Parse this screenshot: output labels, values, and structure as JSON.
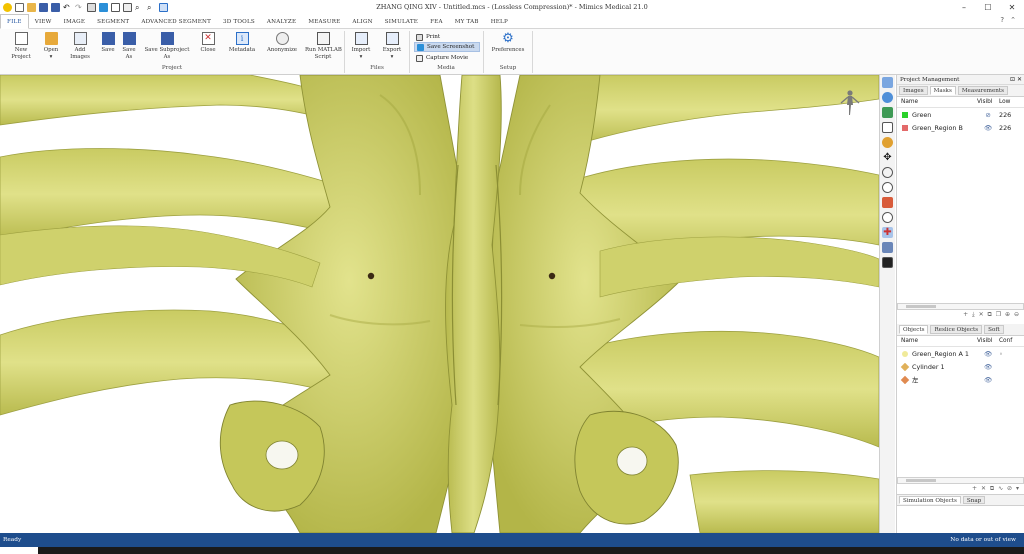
{
  "window": {
    "title": "ZHANG QING XIV - Untitled.mcs - (Lossless Compression)* - Mimics Medical 21.0",
    "controls": [
      "–",
      "☐",
      "✕"
    ]
  },
  "menu": {
    "tabs": [
      "FILE",
      "VIEW",
      "IMAGE",
      "SEGMENT",
      "ADVANCED SEGMENT",
      "3D TOOLS",
      "ANALYZE",
      "MEASURE",
      "ALIGN",
      "SIMULATE",
      "FEA",
      "MY TAB",
      "HELP"
    ],
    "active": "FILE",
    "right_icons": [
      "?",
      "⌃"
    ]
  },
  "ribbon": {
    "project_buttons": [
      {
        "label": "New\nProject",
        "icon": "new-project-icon"
      },
      {
        "label": "Open\n▾",
        "icon": "open-folder-icon"
      },
      {
        "label": "Add\nImages",
        "icon": "add-images-icon"
      },
      {
        "label": "Save",
        "icon": "save-icon"
      },
      {
        "label": "Save\nAs",
        "icon": "save-as-icon"
      },
      {
        "label": "Save Subproject\nAs",
        "icon": "save-subproject-icon"
      },
      {
        "label": "Close",
        "icon": "close-doc-icon"
      },
      {
        "label": "Metadata",
        "icon": "metadata-icon"
      },
      {
        "label": "Anonymize",
        "icon": "anonymize-icon"
      },
      {
        "label": "Run MATLAB\nScript",
        "icon": "matlab-icon"
      }
    ],
    "files_buttons": [
      {
        "label": "Import\n▾",
        "icon": "import-icon"
      },
      {
        "label": "Export\n▾",
        "icon": "export-icon"
      }
    ],
    "media_buttons": [
      {
        "label": "Print",
        "icon": "print-icon",
        "highlighted": false
      },
      {
        "label": "Save Screenshot",
        "icon": "screenshot-icon",
        "highlighted": true
      },
      {
        "label": "Capture Movie",
        "icon": "movie-icon",
        "highlighted": false
      }
    ],
    "setup_buttons": [
      {
        "label": "Preferences",
        "icon": "gear-icon"
      }
    ],
    "groups": {
      "project": "Project",
      "files": "Files",
      "media": "Media",
      "setup": "Setup"
    }
  },
  "panel": {
    "title": "Project Management",
    "top_tabs": [
      "Images",
      "Masks",
      "Measurements"
    ],
    "top_active": "Masks",
    "mask_columns": [
      "Name",
      "Visibl",
      "Low"
    ],
    "masks": [
      {
        "name": "Green",
        "color": "#2bd12b",
        "visible": "⊘",
        "low": "226"
      },
      {
        "name": "Green_Region B",
        "color": "#e36a6a",
        "visible": "👁",
        "low": "226"
      }
    ],
    "mask_tools": "+ ⤓ ✕ ⧉ ❐ ⊕ ⊖",
    "bottom_tabs": [
      "Objects",
      "Reslice Objects",
      "Soft"
    ],
    "bottom_active": "Objects",
    "object_columns": [
      "Name",
      "Visibl",
      "Conf"
    ],
    "objects": [
      {
        "name": "Green_Region A 1",
        "icon": "surface-object-icon",
        "icon_color": "#f0ea9a",
        "visible": "👁",
        "conf": "◦"
      },
      {
        "name": "Cylinder 1",
        "icon": "cylinder-icon",
        "icon_color": "#e0b15a",
        "visible": "👁",
        "conf": ""
      },
      {
        "name": "左",
        "icon": "cylinder-icon",
        "icon_color": "#e08a50",
        "visible": "👁",
        "conf": ""
      }
    ],
    "object_tools": "+ ✕ ⧉ ∿ ⊘ ▾",
    "footer_tabs": [
      "Simulation Objects",
      "Snap"
    ]
  },
  "status": {
    "left": "Ready",
    "right": "No data or out of view"
  },
  "colors": {
    "bone": "#d6d77a",
    "bone_shadow": "#8f9236",
    "status_bar": "#1e4d8c",
    "accent": "#1a4d9c"
  }
}
